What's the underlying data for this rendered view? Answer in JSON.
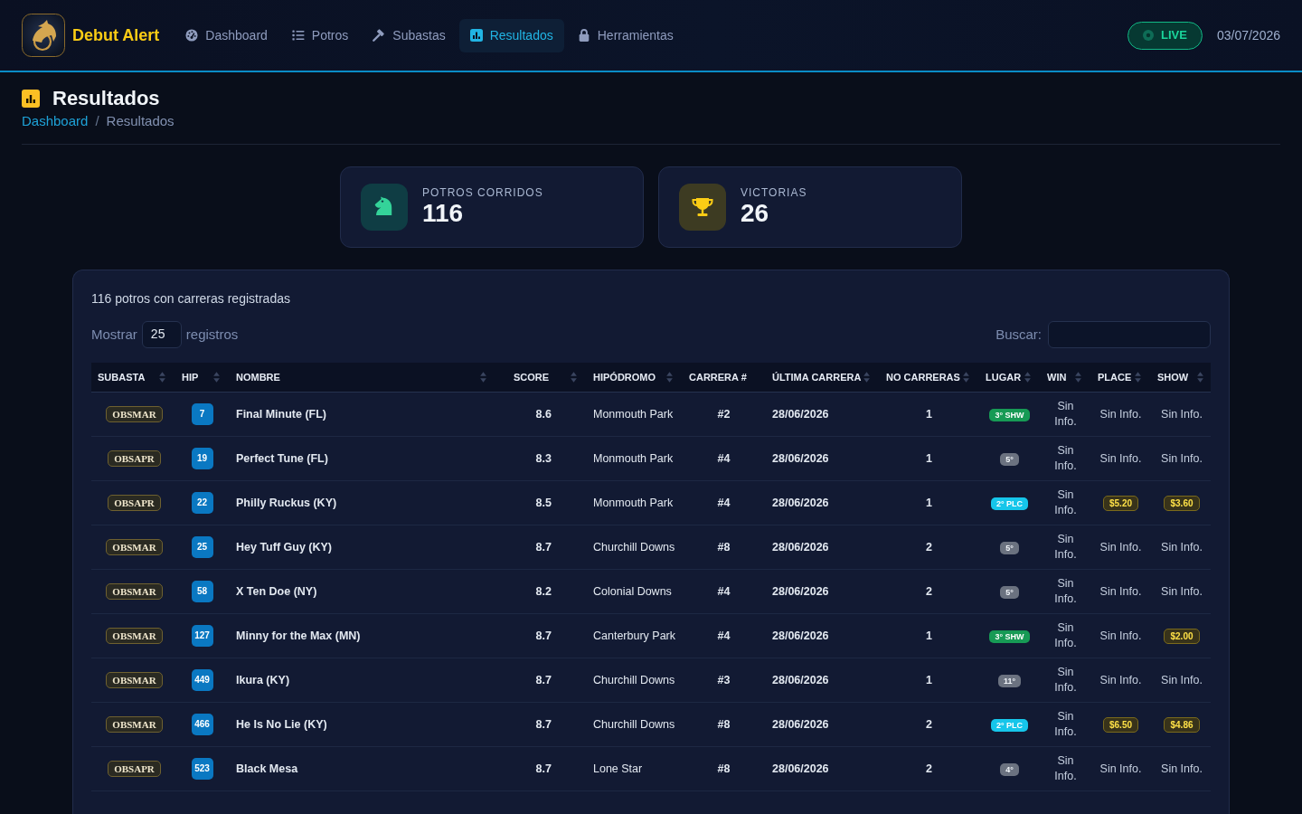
{
  "navbar": {
    "brand": "Debut Alert",
    "items": [
      {
        "label": "Dashboard",
        "selected": false
      },
      {
        "label": "Potros",
        "selected": false
      },
      {
        "label": "Subastas",
        "selected": false
      },
      {
        "label": "Resultados",
        "selected": true
      },
      {
        "label": "Herramientas",
        "selected": false
      }
    ],
    "live_label": "LIVE",
    "date": "03/07/2026"
  },
  "page_header": {
    "title": "Resultados",
    "breadcrumb": {
      "items": [
        {
          "label": "Dashboard",
          "kind": "link"
        },
        {
          "label": "Resultados",
          "kind": "current"
        }
      ],
      "separator": "/"
    }
  },
  "stats": [
    {
      "label": "POTROS CORRIDOS",
      "value": "116"
    },
    {
      "label": "VICTORIAS",
      "value": "26"
    }
  ],
  "results": {
    "summary": "116 potros con carreras registradas",
    "length_menu": {
      "label_before": "Mostrar",
      "value": "25",
      "label_after": "registros"
    },
    "search": {
      "label": "Buscar:"
    },
    "table": {
      "columns": [
        {
          "label": "SUBASTA",
          "sortable": true
        },
        {
          "label": "HIP",
          "sortable": true
        },
        {
          "label": "NOMBRE",
          "sortable": true
        },
        {
          "label": "SCORE",
          "sortable": true
        },
        {
          "label": "HIPÓDROMO",
          "sortable": true
        },
        {
          "label": "CARRERA #",
          "sortable": false
        },
        {
          "label": "ÚLTIMA CARRERA",
          "sortable": true
        },
        {
          "label": "NO CARRERAS",
          "sortable": true
        },
        {
          "label": "LUGAR",
          "sortable": true
        },
        {
          "label": "WIN",
          "sortable": true
        },
        {
          "label": "PLACE",
          "sortable": true
        },
        {
          "label": "SHOW",
          "sortable": true
        }
      ],
      "rows": [
        {
          "subasta": "OBSMAR",
          "hip": "7",
          "nombre": "Final Minute (FL)",
          "score": "8.6",
          "hipodromo": "Monmouth Park",
          "carrera": "#2",
          "ultima_carrera": "28/06/2026",
          "no_carreras": "1",
          "lugar": {
            "text": "3° SHW",
            "kind": "show"
          },
          "win": {
            "text": "Sin Info.",
            "kind": "none"
          },
          "place": {
            "text": "Sin Info.",
            "kind": "none"
          },
          "show": {
            "text": "Sin Info.",
            "kind": "none"
          }
        },
        {
          "subasta": "OBSAPR",
          "hip": "19",
          "nombre": "Perfect Tune (FL)",
          "score": "8.3",
          "hipodromo": "Monmouth Park",
          "carrera": "#4",
          "ultima_carrera": "28/06/2026",
          "no_carreras": "1",
          "lugar": {
            "text": "5°",
            "kind": "other"
          },
          "win": {
            "text": "Sin Info.",
            "kind": "none"
          },
          "place": {
            "text": "Sin Info.",
            "kind": "none"
          },
          "show": {
            "text": "Sin Info.",
            "kind": "none"
          }
        },
        {
          "subasta": "OBSAPR",
          "hip": "22",
          "nombre": "Philly Ruckus (KY)",
          "score": "8.5",
          "hipodromo": "Monmouth Park",
          "carrera": "#4",
          "ultima_carrera": "28/06/2026",
          "no_carreras": "1",
          "lugar": {
            "text": "2° PLC",
            "kind": "place"
          },
          "win": {
            "text": "Sin Info.",
            "kind": "none"
          },
          "place": {
            "text": "$5.20",
            "kind": "payout"
          },
          "show": {
            "text": "$3.60",
            "kind": "payout"
          }
        },
        {
          "subasta": "OBSMAR",
          "hip": "25",
          "nombre": "Hey Tuff Guy (KY)",
          "score": "8.7",
          "hipodromo": "Churchill Downs",
          "carrera": "#8",
          "ultima_carrera": "28/06/2026",
          "no_carreras": "2",
          "lugar": {
            "text": "5°",
            "kind": "other"
          },
          "win": {
            "text": "Sin Info.",
            "kind": "none"
          },
          "place": {
            "text": "Sin Info.",
            "kind": "none"
          },
          "show": {
            "text": "Sin Info.",
            "kind": "none"
          }
        },
        {
          "subasta": "OBSMAR",
          "hip": "58",
          "nombre": "X Ten Doe (NY)",
          "score": "8.2",
          "hipodromo": "Colonial Downs",
          "carrera": "#4",
          "ultima_carrera": "28/06/2026",
          "no_carreras": "2",
          "lugar": {
            "text": "5°",
            "kind": "other"
          },
          "win": {
            "text": "Sin Info.",
            "kind": "none"
          },
          "place": {
            "text": "Sin Info.",
            "kind": "none"
          },
          "show": {
            "text": "Sin Info.",
            "kind": "none"
          }
        },
        {
          "subasta": "OBSMAR",
          "hip": "127",
          "nombre": "Minny for the Max (MN)",
          "score": "8.7",
          "hipodromo": "Canterbury Park",
          "carrera": "#4",
          "ultima_carrera": "28/06/2026",
          "no_carreras": "1",
          "lugar": {
            "text": "3° SHW",
            "kind": "show"
          },
          "win": {
            "text": "Sin Info.",
            "kind": "none"
          },
          "place": {
            "text": "Sin Info.",
            "kind": "none"
          },
          "show": {
            "text": "$2.00",
            "kind": "payout"
          }
        },
        {
          "subasta": "OBSMAR",
          "hip": "449",
          "nombre": "Ikura (KY)",
          "score": "8.7",
          "hipodromo": "Churchill Downs",
          "carrera": "#3",
          "ultima_carrera": "28/06/2026",
          "no_carreras": "1",
          "lugar": {
            "text": "11°",
            "kind": "other"
          },
          "win": {
            "text": "Sin Info.",
            "kind": "none"
          },
          "place": {
            "text": "Sin Info.",
            "kind": "none"
          },
          "show": {
            "text": "Sin Info.",
            "kind": "none"
          }
        },
        {
          "subasta": "OBSMAR",
          "hip": "466",
          "nombre": "He Is No Lie (KY)",
          "score": "8.7",
          "hipodromo": "Churchill Downs",
          "carrera": "#8",
          "ultima_carrera": "28/06/2026",
          "no_carreras": "2",
          "lugar": {
            "text": "2° PLC",
            "kind": "place"
          },
          "win": {
            "text": "Sin Info.",
            "kind": "none"
          },
          "place": {
            "text": "$6.50",
            "kind": "payout"
          },
          "show": {
            "text": "$4.86",
            "kind": "payout"
          }
        },
        {
          "subasta": "OBSAPR",
          "hip": "523",
          "nombre": "Black Mesa",
          "score": "8.7",
          "hipodromo": "Lone Star",
          "carrera": "#8",
          "ultima_carrera": "28/06/2026",
          "no_carreras": "2",
          "lugar": {
            "text": "4°",
            "kind": "other"
          },
          "win": {
            "text": "Sin Info.",
            "kind": "none"
          },
          "place": {
            "text": "Sin Info.",
            "kind": "none"
          },
          "show": {
            "text": "Sin Info.",
            "kind": "none"
          }
        }
      ]
    }
  }
}
